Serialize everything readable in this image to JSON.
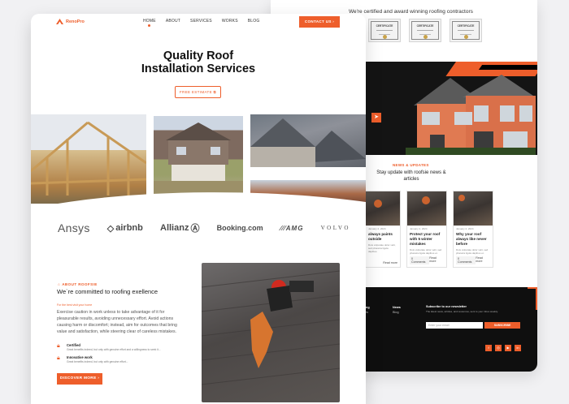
{
  "back": {
    "cert_heading": "We're certified and award winning roofing contractors",
    "certificates": [
      "CERTIFICATE",
      "CERTIFICATE",
      "CERTIFICATE"
    ],
    "news_tag": "NEWS & UPDATES",
    "news_title": "Stay update with roofsie news & articles",
    "blog_posts": [
      {
        "meta": "January 2, 2024",
        "title": "always paints outside",
        "excerpt": "Duis vulputate dolor velit, sed pharetra ligula dapibus.",
        "tag": "",
        "link": "Read more"
      },
      {
        "meta": "January 2, 2024",
        "title": "Protect your roof with 5 winter mistakes",
        "excerpt": "Duis vulputate dolor velit, sed pharetra ligula dapibus et.",
        "tag": "0 Comments",
        "link": "Read more"
      },
      {
        "meta": "January 2, 2024",
        "title": "Why your roof always like never before",
        "excerpt": "Duis vulputate dolor velit, sed pharetra ligula dapibus et.",
        "tag": "0 Comments",
        "link": "Read more"
      }
    ],
    "footer": {
      "col1": [
        "ing",
        "es"
      ],
      "col2_title": "News",
      "col2": [
        "Blog"
      ],
      "subscribe_title": "Subscribe to our newsletter",
      "subscribe_desc": "The latest news, articles, and resources, sent to your inbox weekly.",
      "email_placeholder": "Enter your email",
      "subscribe_btn": "SUBSCRIBE",
      "socials": [
        "f",
        "◎",
        "▶",
        "in"
      ]
    }
  },
  "front": {
    "brand": "RenoPro",
    "menu": [
      "HOME",
      "ABOUT",
      "SERVICES",
      "WORKS",
      "BLOG"
    ],
    "active_menu": "HOME",
    "contact_btn": "CONTACT US",
    "title_line1": "Quality Roof",
    "title_line2": "Installation Services",
    "estimate_btn": "FREE ESTIMATE",
    "logos": [
      "Ansys",
      "airbnb",
      "Allianz",
      "Booking.com",
      "AMG",
      "VOLVO"
    ],
    "about_tag": "ABOUT ROOFSIE",
    "about_heading": "We`re committed to roofing exellence",
    "about_sub": "For the best visit your home",
    "about_text": "Exercise caution in work unless to take advantage of it for pleasurable results, avoiding unnecessary effort. Avoid actions causing harm or discomfort; instead, aim for outcomes that bring value and satisfaction, while steering clear of careless mistakes.",
    "features": [
      {
        "title": "Certified",
        "desc": "Great benefits indeed, but only with genuine effort and a willingness to seek it..."
      },
      {
        "title": "Innovative work",
        "desc": "Great benefits indeed, but only with genuine effort..."
      }
    ],
    "discover_btn": "DISCOVER MORE"
  },
  "colors": {
    "accent": "#ee5e2b",
    "dark": "#0f0f0f"
  }
}
